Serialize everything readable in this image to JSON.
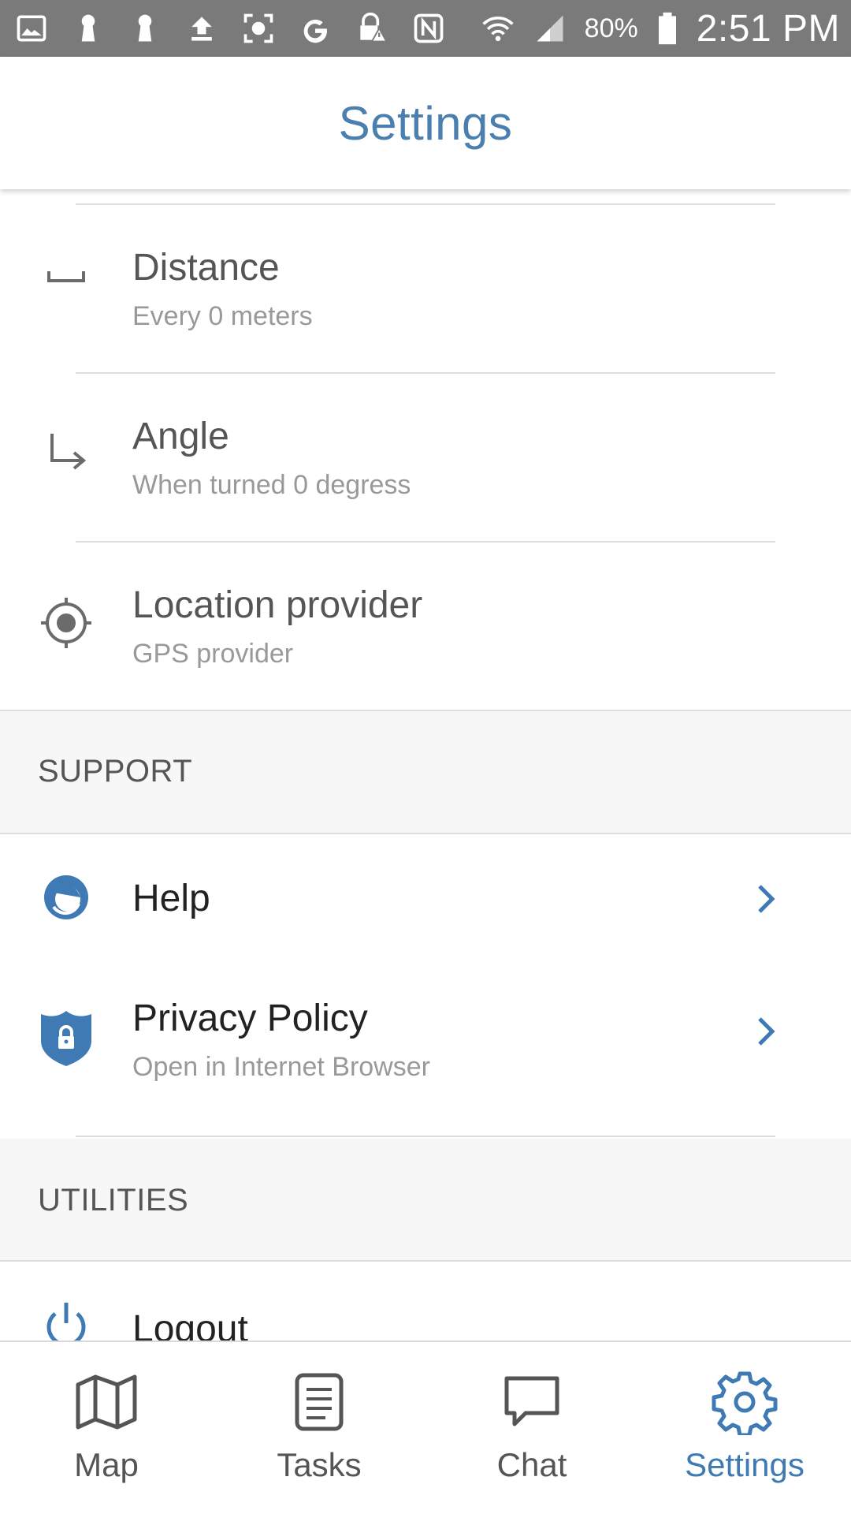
{
  "status_bar": {
    "battery": "80%",
    "time": "2:51 PM",
    "left_icons": [
      "gallery-icon",
      "keyhole-icon",
      "keyhole-icon",
      "upload-icon",
      "screenshot-icon",
      "google-icon",
      "lock-warning-icon",
      "nfc-icon"
    ],
    "right_icons": [
      "wifi-icon",
      "signal-icon",
      "battery-icon"
    ]
  },
  "header": {
    "title": "Settings"
  },
  "tracking": {
    "distance": {
      "title": "Distance",
      "subtitle": "Every 0 meters",
      "icon": "ruler-icon"
    },
    "angle": {
      "title": "Angle",
      "subtitle": "When turned 0 degress",
      "icon": "turn-arrow-icon"
    },
    "location_provider": {
      "title": "Location provider",
      "subtitle": "GPS provider",
      "icon": "crosshair-icon"
    }
  },
  "support": {
    "section_label": "SUPPORT",
    "help": {
      "title": "Help",
      "icon": "headset-icon"
    },
    "privacy": {
      "title": "Privacy Policy",
      "subtitle": "Open in Internet Browser",
      "icon": "shield-lock-icon"
    }
  },
  "utilities": {
    "section_label": "UTILITIES",
    "logout": {
      "title": "Logout",
      "icon": "power-icon"
    }
  },
  "bottom_nav": {
    "items": [
      {
        "label": "Map",
        "icon": "map-icon",
        "active": false
      },
      {
        "label": "Tasks",
        "icon": "document-icon",
        "active": false
      },
      {
        "label": "Chat",
        "icon": "chat-bubble-icon",
        "active": false
      },
      {
        "label": "Settings",
        "icon": "gear-icon",
        "active": true
      }
    ]
  },
  "colors": {
    "accent": "#4a7fb0",
    "status_bar": "#7a7a7a",
    "section_bg": "#f7f7f7",
    "icon_gray": "#6b6b6b"
  }
}
